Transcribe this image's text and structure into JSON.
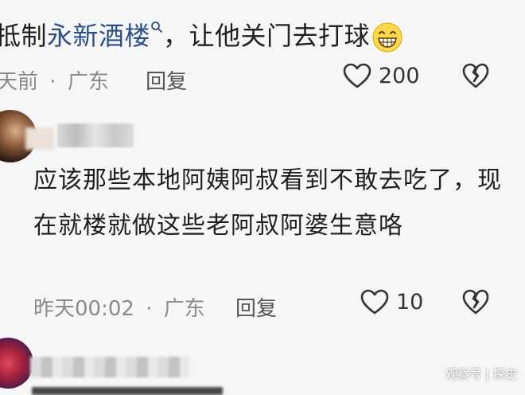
{
  "comment1": {
    "text_prefix": "抵制",
    "link": "永新酒楼",
    "text_suffix": "，让他关门去打球",
    "time": "天前",
    "separator": "·",
    "location": "广东",
    "reply_label": "回复",
    "likes": "200",
    "icons": {
      "search": "search-icon",
      "emoji": "grin-emoji-icon",
      "like": "heart-icon",
      "dislike": "broken-heart-icon"
    }
  },
  "comment2": {
    "text": "应该那些本地阿姨阿叔看到不敢去吃了，现在就楼就做这些老阿叔阿婆生意咯",
    "time": "昨天00:02",
    "separator": "·",
    "location": "广东",
    "reply_label": "回复",
    "likes": "10",
    "icons": {
      "like": "heart-icon",
      "dislike": "broken-heart-icon"
    }
  },
  "watermark": "观察号 | 探史",
  "colors": {
    "link": "#2a4e8a",
    "meta": "#8a8a8a",
    "background": "#f6f6f6"
  }
}
